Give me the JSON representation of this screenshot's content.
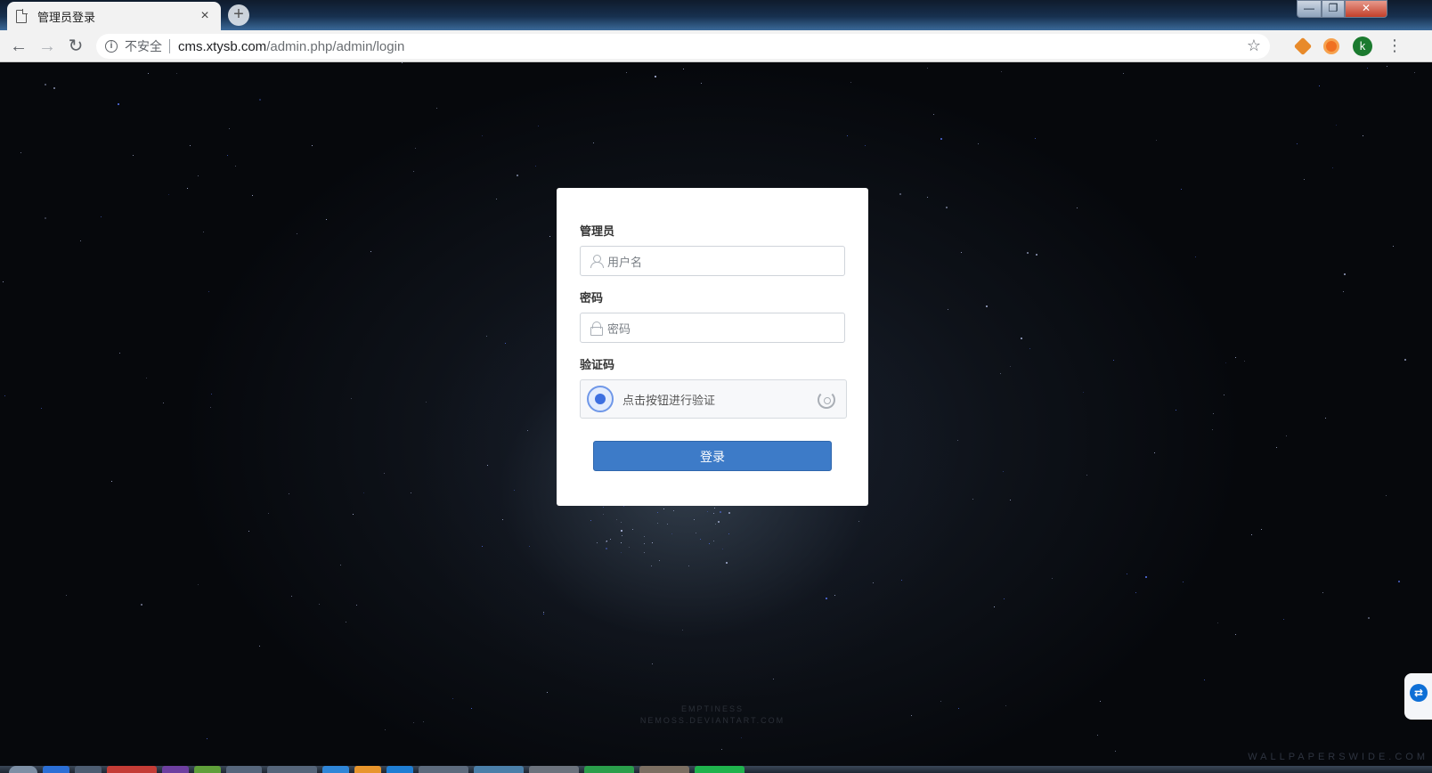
{
  "browser": {
    "tab": {
      "title": "管理员登录",
      "close": "×"
    },
    "new_tab": "+",
    "window_controls": {
      "minimize": "—",
      "maximize": "❐",
      "close": "✕"
    },
    "nav": {
      "back": "←",
      "forward": "→",
      "reload": "↻"
    },
    "address": {
      "security_label": "不安全",
      "host": "cms.xtysb.com",
      "path": "/admin.php/admin/login"
    },
    "bookmark": "☆",
    "profile_initial": "k",
    "menu": "⋮"
  },
  "login": {
    "admin_label": "管理员",
    "username_placeholder": "用户名",
    "password_label": "密码",
    "password_placeholder": "密码",
    "captcha_label": "验证码",
    "captcha_prompt": "点击按钮进行验证",
    "submit_label": "登录"
  },
  "wallpaper": {
    "credit_line1": "EMPTINESS",
    "credit_line2": "NEMOSS.DEVIANTART.COM",
    "site_mark": "WALLPAPERSWIDE.COM"
  },
  "colors": {
    "primary_button": "#3d7bc8",
    "captcha_accent": "#3d6fe0",
    "profile_avatar": "#1b7a2f"
  }
}
